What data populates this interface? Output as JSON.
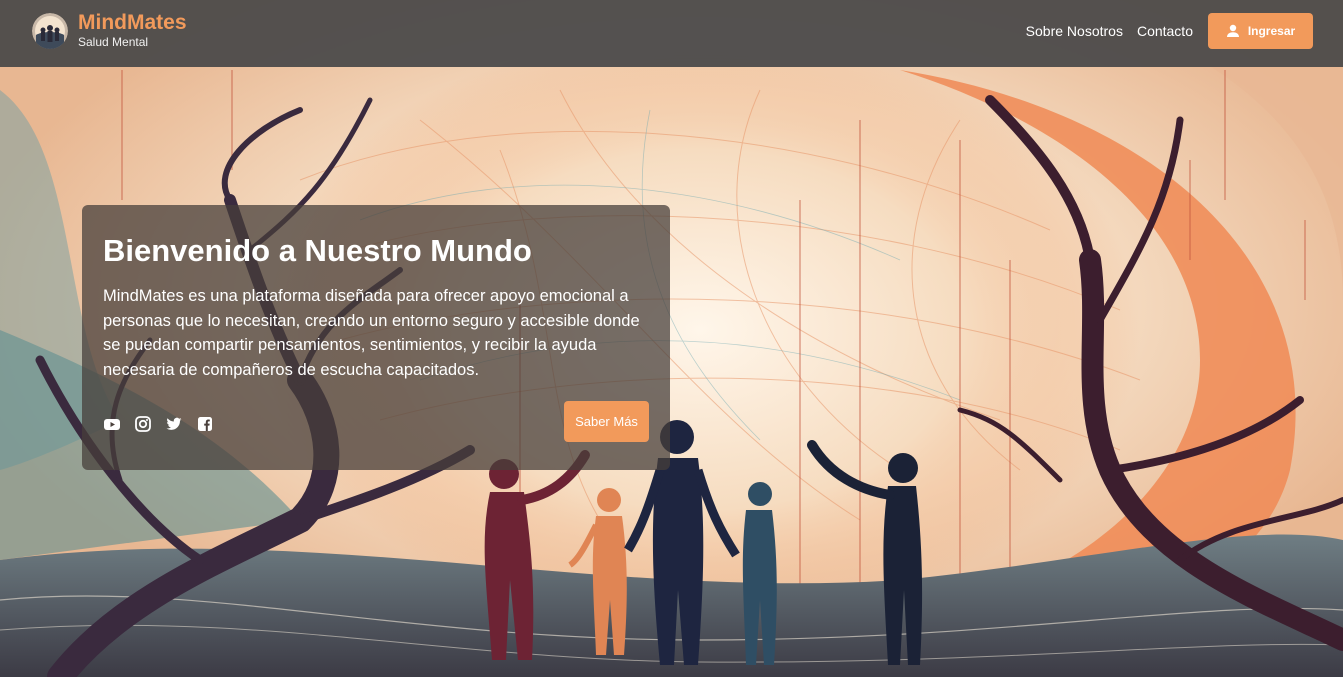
{
  "brand": {
    "name": "MindMates",
    "tagline": "Salud Mental",
    "logo_icon": "people-globe-logo",
    "color": "#f29a5b"
  },
  "nav": {
    "links": [
      {
        "label": "Sobre Nosotros"
      },
      {
        "label": "Contacto"
      }
    ],
    "login": {
      "label": "Ingresar",
      "icon": "user-icon"
    }
  },
  "hero": {
    "title": "Bienvenido a Nuestro Mundo",
    "description": "MindMates es una plataforma diseñada para ofrecer apoyo emocional a personas que lo necesitan, creando un entorno seguro y accesible donde se puedan compartir pensamientos, sentimientos, y recibir la ayuda necesaria de compañeros de escucha capacitados.",
    "cta_label": "Saber Más",
    "socials": [
      "youtube-icon",
      "instagram-icon",
      "twitter-icon",
      "facebook-icon"
    ]
  },
  "colors": {
    "accent": "#f29a5b",
    "navbar": "#464648"
  }
}
